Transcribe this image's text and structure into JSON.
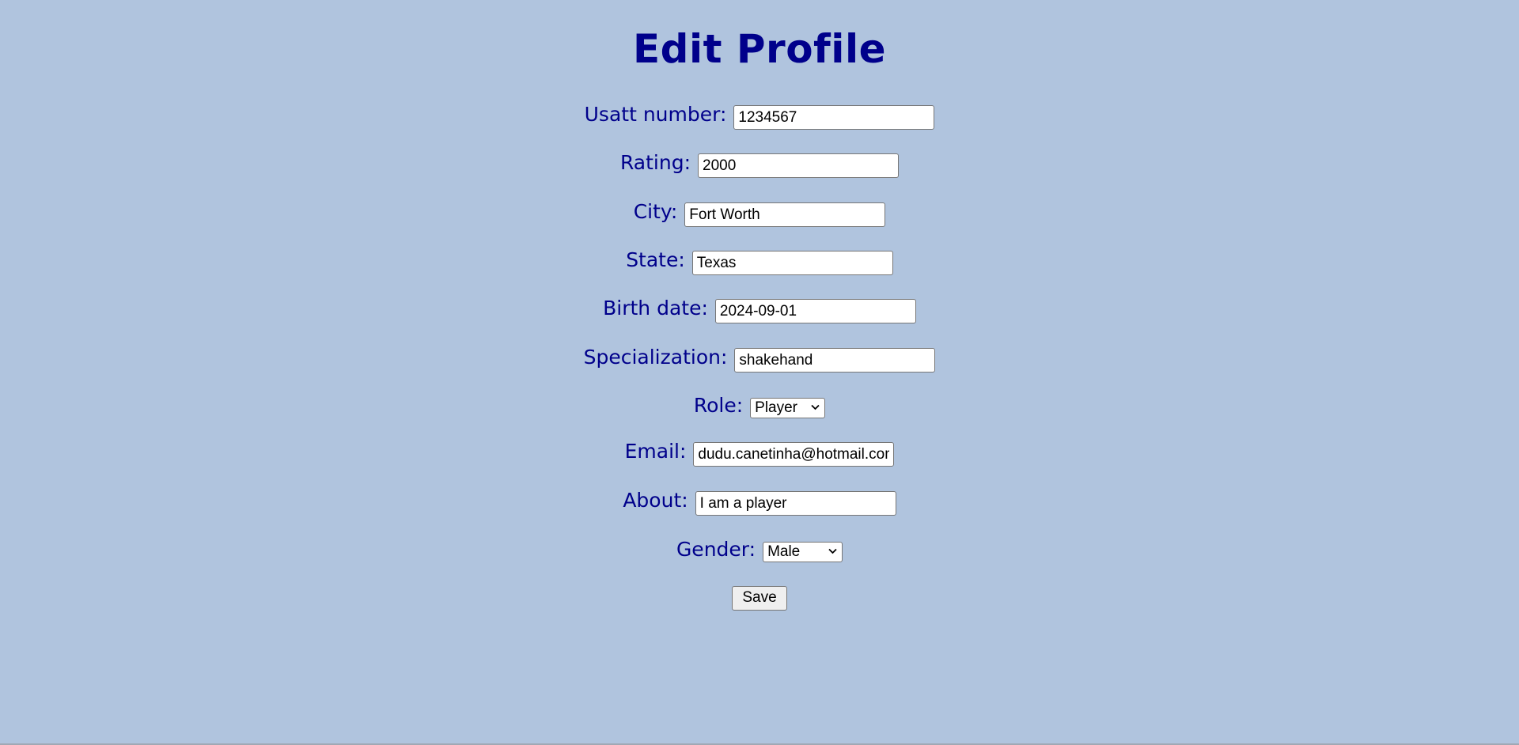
{
  "page": {
    "title": "Edit Profile",
    "background_color": "#b0c4de",
    "text_color": "#00008b"
  },
  "form": {
    "usatt": {
      "label": "Usatt number:",
      "value": "1234567"
    },
    "rating": {
      "label": "Rating:",
      "value": "2000"
    },
    "city": {
      "label": "City:",
      "value": "Fort Worth"
    },
    "state": {
      "label": "State:",
      "value": "Texas"
    },
    "birth_date": {
      "label": "Birth date:",
      "value": "2024-09-01"
    },
    "specialization": {
      "label": "Specialization:",
      "value": "shakehand"
    },
    "role": {
      "label": "Role:",
      "selected": "Player",
      "icon": "chevron-down-icon"
    },
    "email": {
      "label": "Email:",
      "value": "dudu.canetinha@hotmail.com"
    },
    "about": {
      "label": "About:",
      "value": "I am a player"
    },
    "gender": {
      "label": "Gender:",
      "selected": "Male",
      "icon": "chevron-down-icon"
    },
    "save_label": "Save"
  }
}
